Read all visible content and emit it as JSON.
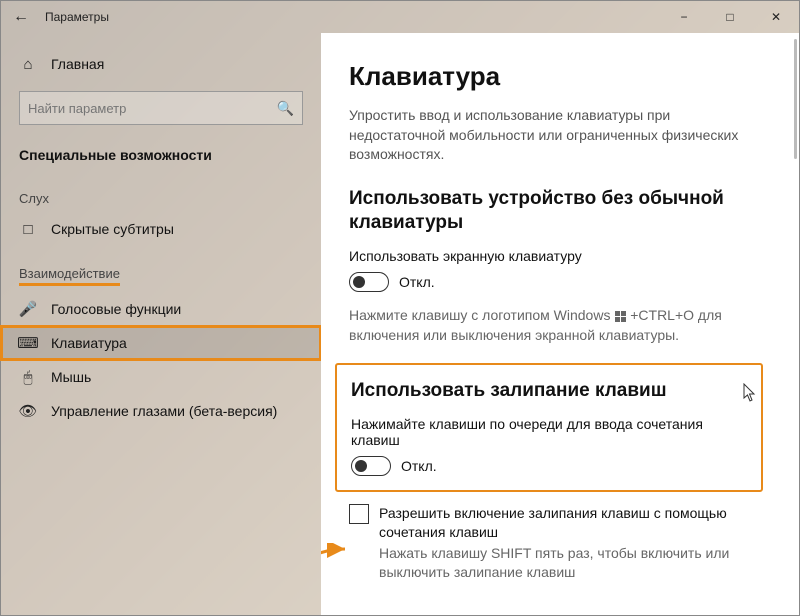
{
  "titlebar": {
    "title": "Параметры"
  },
  "sidebar": {
    "home": "Главная",
    "search_placeholder": "Найти параметр",
    "section": "Специальные возможности",
    "group_hearing": "Слух",
    "group_interaction": "Взаимодействие",
    "items": {
      "captions": "Скрытые субтитры",
      "speech": "Голосовые функции",
      "keyboard": "Клавиатура",
      "mouse": "Мышь",
      "eye": "Управление глазами (бета-версия)"
    }
  },
  "content": {
    "title": "Клавиатура",
    "intro": "Упростить ввод и использование клавиатуры при недостаточной мобильности или ограниченных физических возможностях.",
    "osk_heading": "Использовать устройство без обычной клавиатуры",
    "osk_label": "Использовать экранную клавиатуру",
    "toggle_off": "Откл.",
    "osk_hint_pre": "Нажмите клавишу с логотипом Windows ",
    "osk_hint_post": " +CTRL+O для включения или выключения экранной клавиатуры.",
    "sticky_heading": "Использовать залипание клавиш",
    "sticky_label": "Нажимайте клавиши по очереди для ввода сочетания клавиш",
    "sticky_checkbox": "Разрешить включение залипания клавиш с помощью сочетания клавиш",
    "sticky_hint": "Нажать клавишу SHIFT пять раз, чтобы включить или выключить залипание клавиш"
  }
}
